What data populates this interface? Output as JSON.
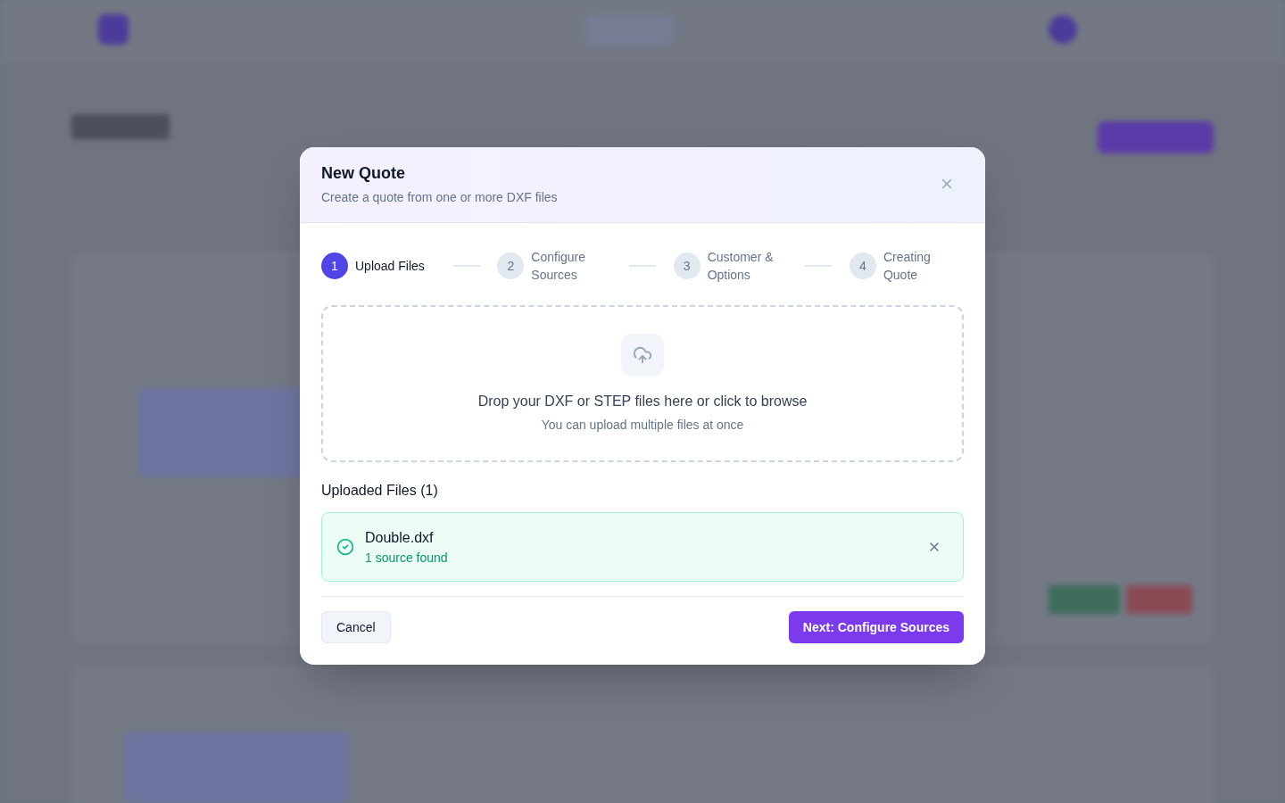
{
  "dialog": {
    "title": "New Quote",
    "subtitle": "Create a quote from one or more DXF files"
  },
  "steps": [
    {
      "number": "1",
      "label": "Upload Files",
      "selected": true
    },
    {
      "number": "2",
      "label": "Configure Sources",
      "selected": false
    },
    {
      "number": "3",
      "label": "Customer & Options",
      "selected": false
    },
    {
      "number": "4",
      "label": "Creating Quote",
      "selected": false
    }
  ],
  "dropzone": {
    "title": "Drop your DXF or STEP files here or click to browse",
    "hint": "You can upload multiple files at once"
  },
  "uploaded": {
    "heading": "Uploaded Files (1)",
    "files": [
      {
        "name": "Double.dxf",
        "status": "1 source found",
        "ok": true
      }
    ]
  },
  "buttons": {
    "cancel": "Cancel",
    "next": "Next: Configure Sources"
  }
}
